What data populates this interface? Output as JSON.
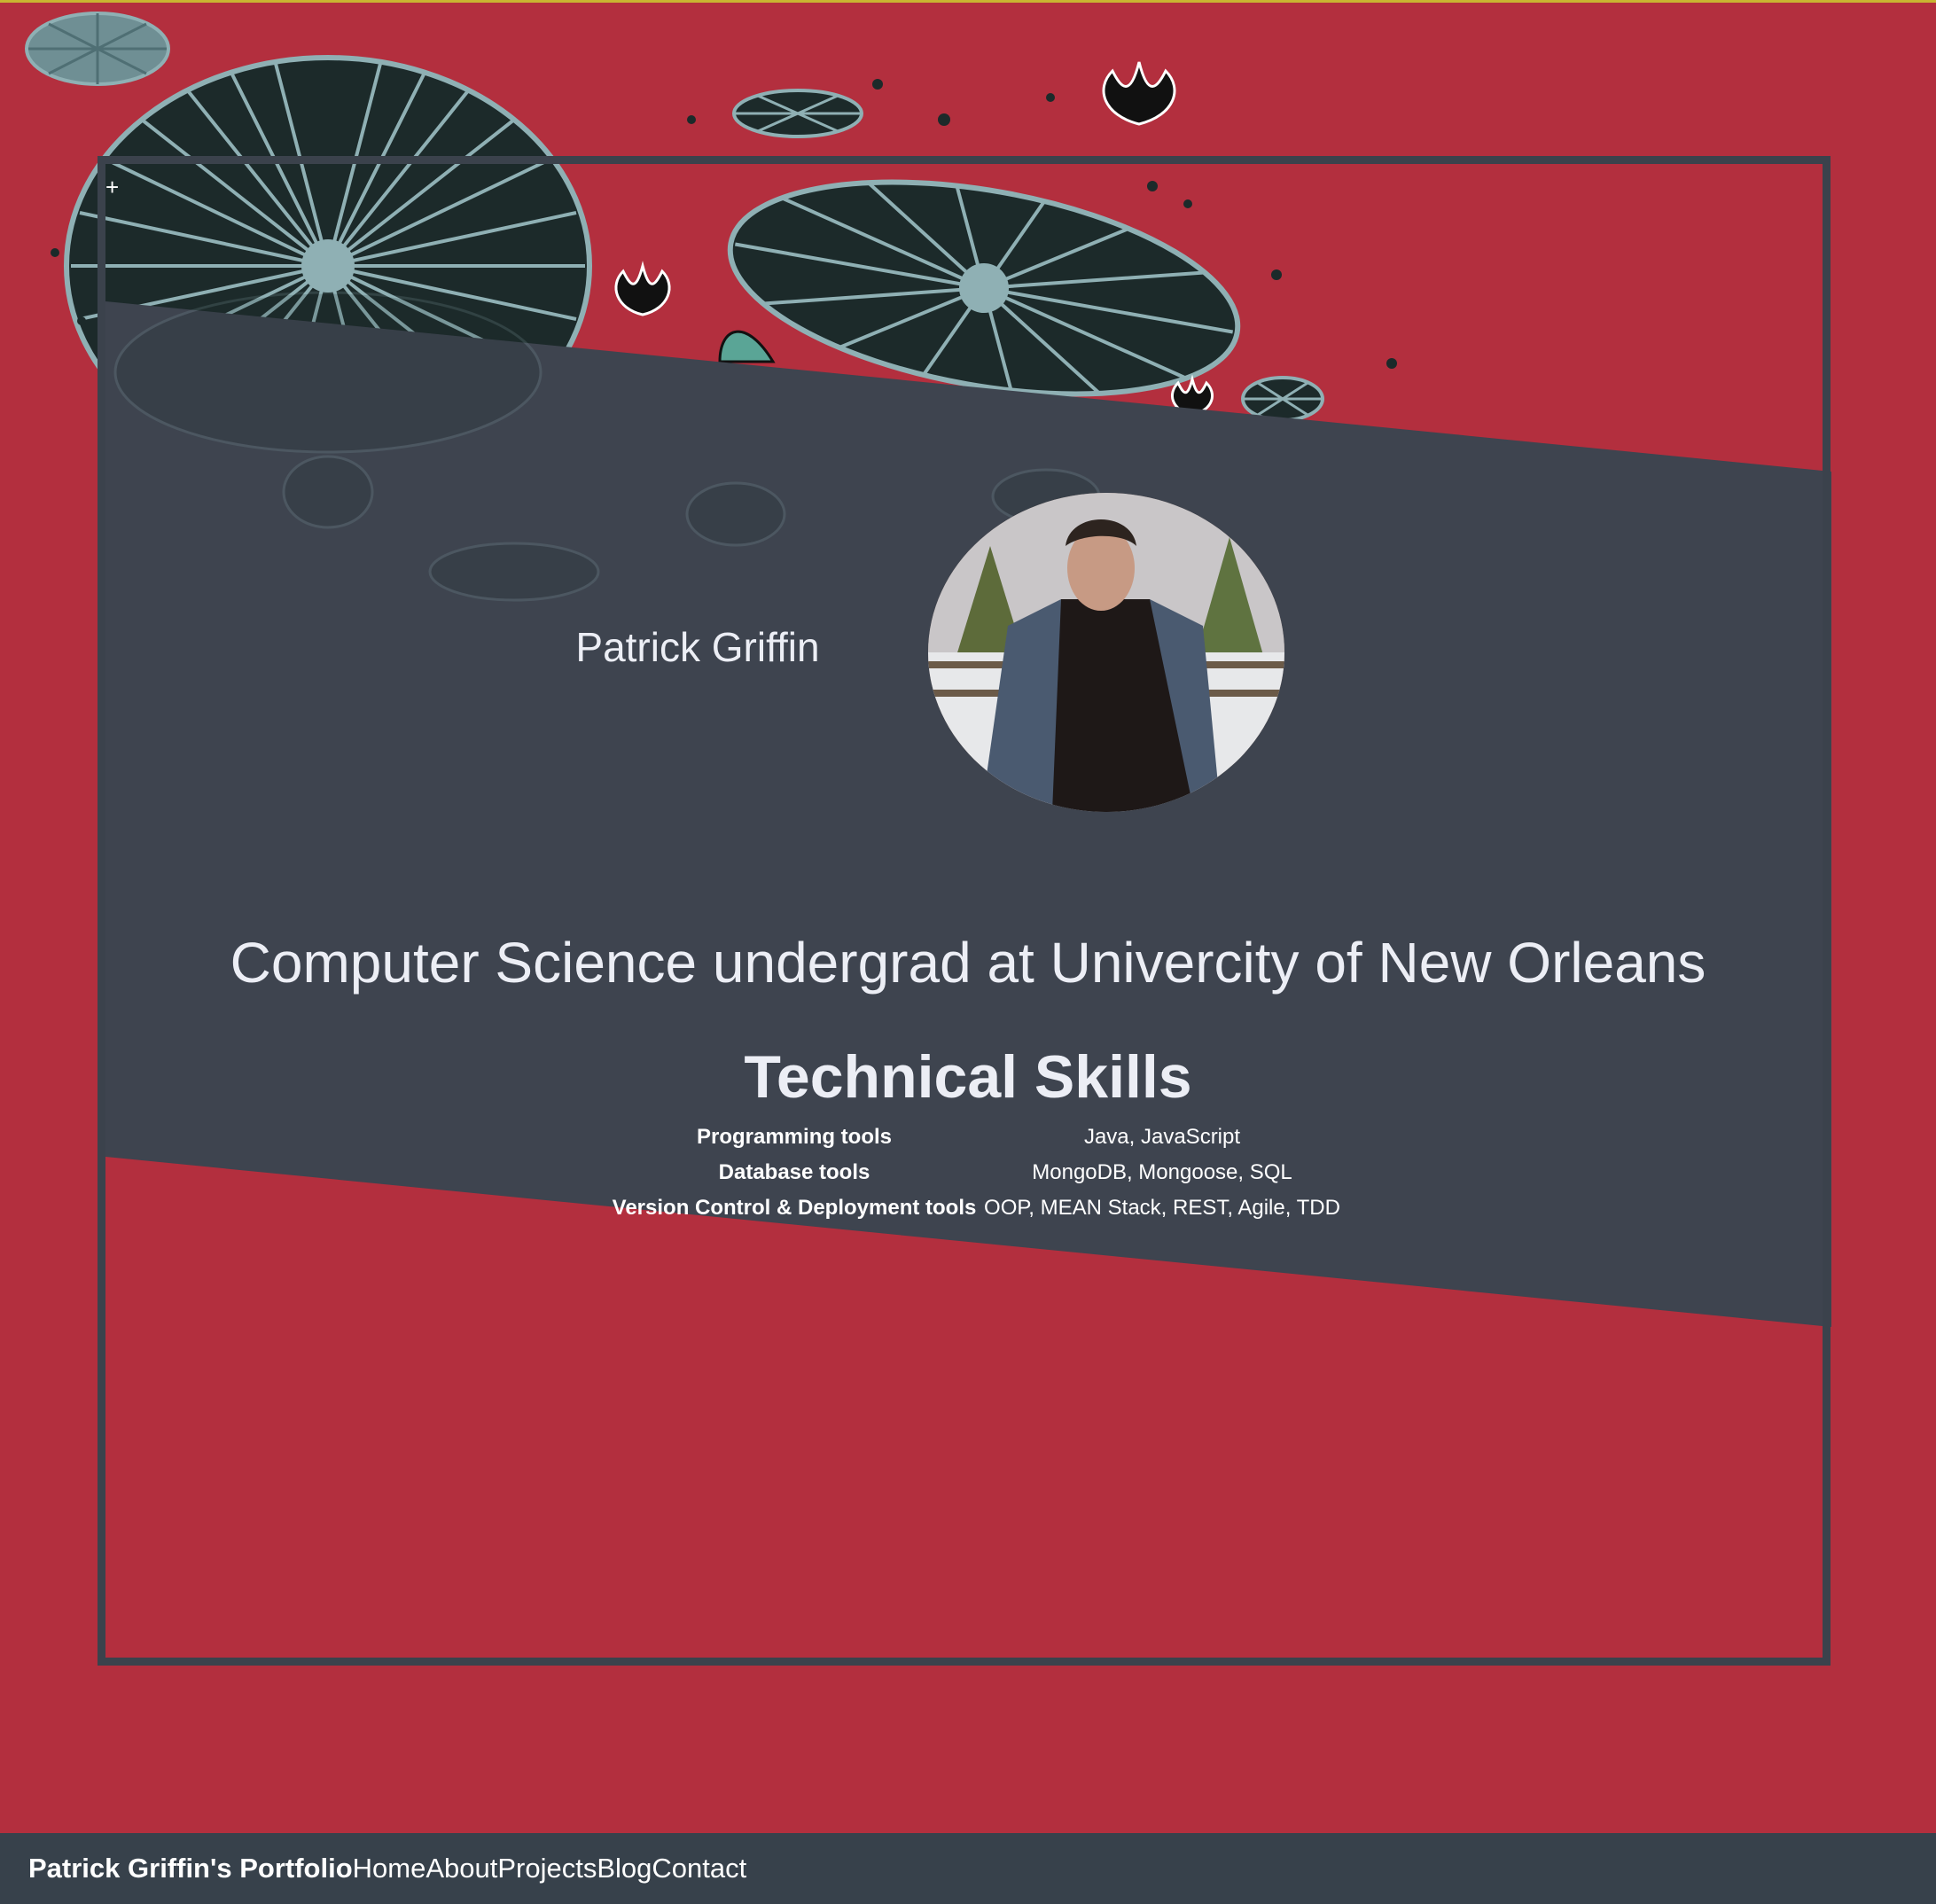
{
  "profile": {
    "name": "Patrick Griffin",
    "subtitle": "Computer Science undergrad at Univercity of New Orleans"
  },
  "skills": {
    "heading": "Technical Skills",
    "rows": [
      {
        "label": "Programming tools",
        "value": "Java, JavaScript"
      },
      {
        "label": "Database tools",
        "value": "MongoDB, Mongoose, SQL"
      },
      {
        "label": "Version Control & Deployment tools",
        "value": "OOP, MEAN Stack, REST, Agile, TDD"
      }
    ]
  },
  "navbar": {
    "brand": "Patrick Griffin's Portfolio",
    "links": [
      "Home",
      "About",
      "Projects",
      "Blog",
      "Contact"
    ]
  },
  "colors": {
    "background": "#b32f3e",
    "panel": "#3e444f",
    "navbar": "#37414b",
    "lily_pad": "#1c2a2a",
    "lily_vein": "#8fb0b4"
  },
  "icons": {
    "plus": "+"
  }
}
